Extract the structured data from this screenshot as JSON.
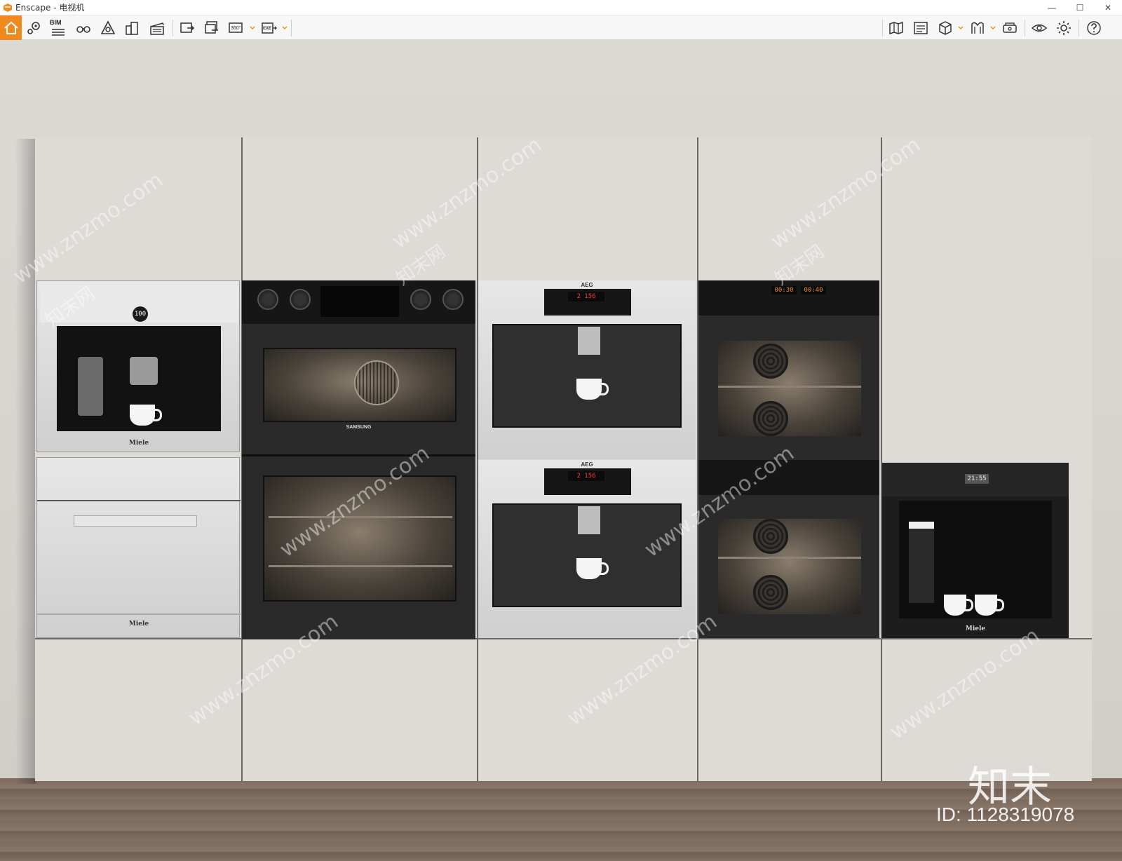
{
  "window": {
    "title": "Enscape - 电视机",
    "accent_color": "#f08a1d"
  },
  "toolbar": {
    "left_buttons": [
      {
        "name": "home-icon"
      },
      {
        "name": "views-icon"
      },
      {
        "name": "bim-icon",
        "label": "BIM"
      },
      {
        "name": "binoculars-icon"
      },
      {
        "name": "measure-icon"
      },
      {
        "name": "buildings-icon"
      },
      {
        "name": "clapper-icon"
      },
      {
        "name": "screenshot-icon"
      },
      {
        "name": "batch-render-icon"
      },
      {
        "name": "panorama-360-icon",
        "label": "360°"
      },
      {
        "name": "export-exe-icon",
        "label": "EXE"
      }
    ],
    "right_buttons": [
      {
        "name": "map-icon"
      },
      {
        "name": "atmosphere-icon"
      },
      {
        "name": "cube-icon"
      },
      {
        "name": "material-icon"
      },
      {
        "name": "vr-headset-icon"
      },
      {
        "name": "visual-settings-icon"
      },
      {
        "name": "settings-gear-icon"
      },
      {
        "name": "help-icon"
      }
    ]
  },
  "scene": {
    "brands": {
      "miele_top": "Miele",
      "miele_bottom": "Miele",
      "samsung": "SAMSUNG",
      "aeg_top": "AEG",
      "aeg_bottom": "AEG",
      "miele_right": "Miele"
    },
    "displays": {
      "aeg_top": "2 156",
      "aeg_bottom": "2 156",
      "miele_coffee": "100",
      "miele_right": "21:55",
      "oven_top_left": "00:30",
      "oven_top_right": "00:40"
    }
  },
  "watermark": {
    "site": "www.znzmo.com",
    "site_cn": "知末网",
    "logo": "知末",
    "id": "ID: 1128319078"
  }
}
